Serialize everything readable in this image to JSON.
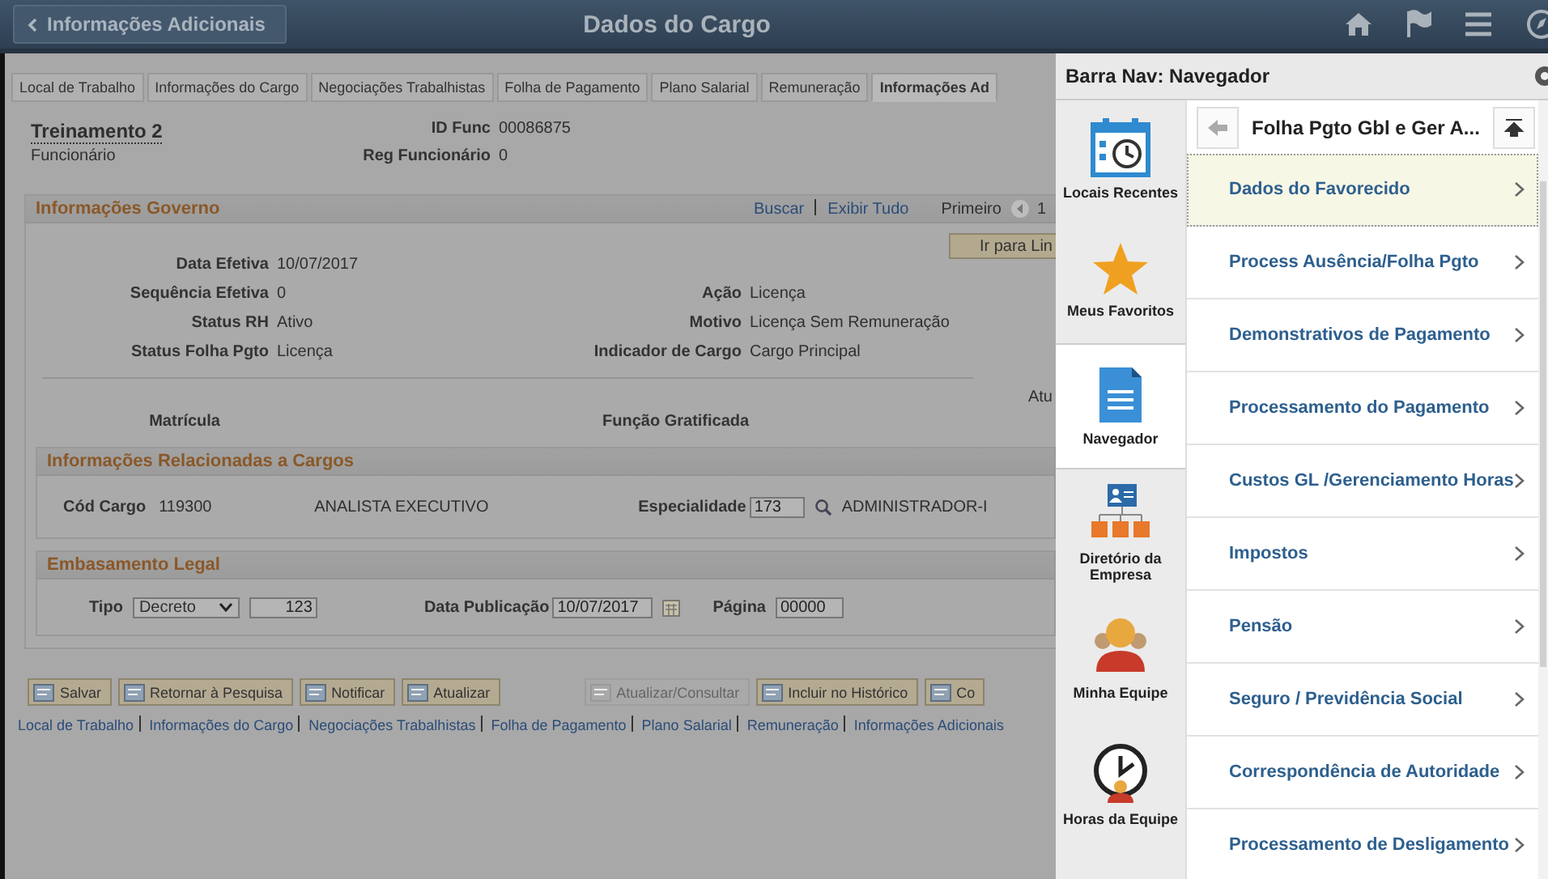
{
  "header": {
    "back_button": "Informações Adicionais",
    "title": "Dados do Cargo"
  },
  "tabs": [
    {
      "label": "Local de Trabalho",
      "selected": false
    },
    {
      "label": "Informações do Cargo",
      "selected": false
    },
    {
      "label": "Negociações Trabalhistas",
      "selected": false
    },
    {
      "label": "Folha de Pagamento",
      "selected": false
    },
    {
      "label": "Plano Salarial",
      "selected": false
    },
    {
      "label": "Remuneração",
      "selected": false
    },
    {
      "label": "Informações Ad",
      "selected": true
    }
  ],
  "employee": {
    "name": "Treinamento 2",
    "type": "Funcionário",
    "fields": [
      {
        "label": "ID Func",
        "value": "00086875"
      },
      {
        "label": "Reg Funcionário",
        "value": "0"
      }
    ]
  },
  "gov_section": {
    "title": "Informações Governo",
    "links": [
      "Buscar",
      "Exibir Tudo"
    ],
    "pager": "Primeiro",
    "pager_number": "1",
    "goto_button": "Ir para Lin",
    "cut_text": "Atu",
    "rows": [
      {
        "left_label": "Data Efetiva",
        "left_value": "10/07/2017"
      },
      {
        "left_label": "Sequência Efetiva",
        "left_value": "0",
        "right_label": "Ação",
        "right_value": "Licença"
      },
      {
        "left_label": "Status RH",
        "left_value": "Ativo",
        "right_label": "Motivo",
        "right_value": "Licença Sem Remuneração"
      },
      {
        "left_label": "Status Folha Pgto",
        "left_value": "Licença",
        "right_label": "Indicador de Cargo",
        "right_value": "Cargo Principal"
      }
    ],
    "column_labels": [
      "Matrícula",
      "Função Gratificada"
    ]
  },
  "related_section": {
    "title": "Informações Relacionadas a Cargos",
    "code_label": "Cód Cargo",
    "code_value": "119300",
    "description": "ANALISTA EXECUTIVO",
    "specialty_label": "Especialidade",
    "specialty_value": "173",
    "specialty_description": "ADMINISTRADOR-I"
  },
  "legal_section": {
    "title": "Embasamento Legal",
    "type_label": "Tipo",
    "type_value": "Decreto",
    "number_value": "123",
    "date_label": "Data Publicação",
    "date_value": "10/07/2017",
    "page_label": "Página",
    "page_value": "00000"
  },
  "buttons": [
    {
      "label": "Salvar",
      "disabled": false
    },
    {
      "label": "Retornar à Pesquisa",
      "disabled": false
    },
    {
      "label": "Notificar",
      "disabled": false
    },
    {
      "label": "Atualizar",
      "disabled": false
    },
    {
      "label": "Atualizar/Consultar",
      "disabled": true
    },
    {
      "label": "Incluir no Histórico",
      "disabled": false
    },
    {
      "label": "Co",
      "disabled": false
    }
  ],
  "footer_links": [
    "Local de Trabalho",
    "Informações do Cargo",
    "Negociações Trabalhistas",
    "Folha de Pagamento",
    "Plano Salarial",
    "Remuneração",
    "Informações Adicionais"
  ],
  "nav_panel": {
    "title": "Barra Nav: Navegador",
    "breadcrumb": "Folha Pgto Gbl e Ger A...",
    "side_items": [
      {
        "label": "Locais Recentes",
        "selected": false,
        "kind": "calendar"
      },
      {
        "label": "Meus Favoritos",
        "selected": false,
        "kind": "star"
      },
      {
        "label": "Navegador",
        "selected": true,
        "kind": "document"
      },
      {
        "label": "Diretório da Empresa",
        "selected": false,
        "kind": "directory"
      },
      {
        "label": "Minha Equipe",
        "selected": false,
        "kind": "team"
      },
      {
        "label": "Horas da Equipe",
        "selected": false,
        "kind": "clock"
      }
    ],
    "items": [
      {
        "label": "Dados do Favorecido",
        "selected": true
      },
      {
        "label": "Process Ausência/Folha Pgto",
        "selected": false
      },
      {
        "label": "Demonstrativos de Pagamento",
        "selected": false
      },
      {
        "label": "Processamento do Pagamento",
        "selected": false
      },
      {
        "label": "Custos GL /Gerenciamento Horas",
        "selected": false
      },
      {
        "label": "Impostos",
        "selected": false
      },
      {
        "label": "Pensão",
        "selected": false
      },
      {
        "label": "Seguro / Previdência Social",
        "selected": false
      },
      {
        "label": "Correspondência de Autoridade",
        "selected": false
      },
      {
        "label": "Processamento de Desligamento",
        "selected": false
      }
    ]
  }
}
